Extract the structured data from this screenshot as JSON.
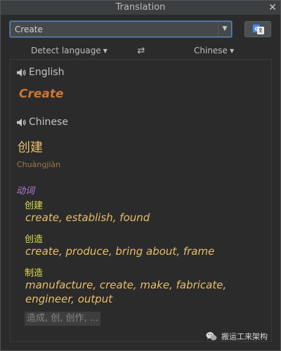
{
  "window": {
    "title": "Translation",
    "close_glyph": "✕"
  },
  "toolbar": {
    "input_value": "Create",
    "dropdown_glyph": "▼",
    "translate_button_icon": "google-translate-icon"
  },
  "lang_bar": {
    "source": "Detect language",
    "source_arrow": "▼",
    "swap_glyph": "⇄",
    "target": "Chinese",
    "target_arrow": "▼"
  },
  "source_section": {
    "language": "English",
    "word": "Create"
  },
  "target_section": {
    "language": "Chinese",
    "word": "创建",
    "transliteration": "Chuàngjiàn",
    "part_of_speech": "动词",
    "entries": [
      {
        "word": "创建",
        "synonyms": "create, establish, found"
      },
      {
        "word": "创造",
        "synonyms": "create, produce, bring about, frame"
      },
      {
        "word": "制造",
        "synonyms": "manufacture, create, make, fabricate, engineer, output"
      }
    ],
    "more": "造成, 创, 创作, ..."
  },
  "watermark": {
    "text": "搬运工来架构",
    "icon": "wechat-icon"
  },
  "colors": {
    "background": "#2b2b2b",
    "source_word": "#cc7832",
    "target_word": "#e8bf6a",
    "part_of_speech": "#b77fe0",
    "entry_word": "#dede4f",
    "focus_border": "#5e86b0"
  }
}
